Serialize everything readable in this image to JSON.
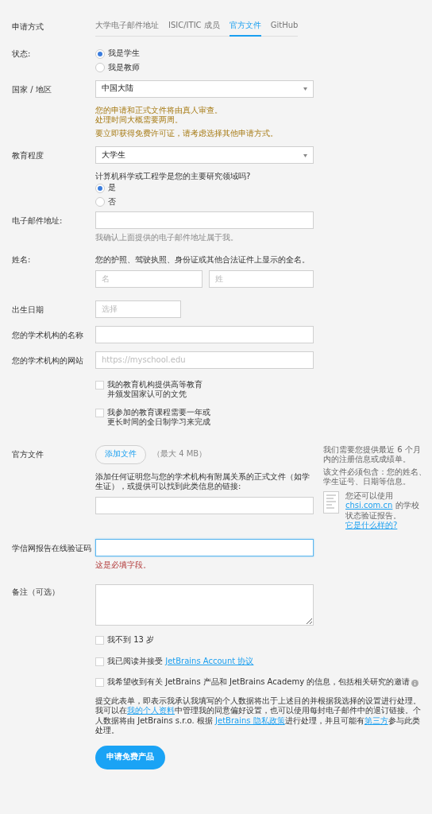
{
  "method": {
    "label": "申请方式",
    "tabs": [
      {
        "label": "大学电子邮件地址",
        "selected": false
      },
      {
        "label": "ISIC/ITIC 成员",
        "selected": false
      },
      {
        "label": "官方文件",
        "selected": true
      },
      {
        "label": "GitHub",
        "selected": false
      }
    ]
  },
  "status": {
    "label": "状态:",
    "options": [
      {
        "label": "我是学生",
        "selected": true
      },
      {
        "label": "我是教师",
        "selected": false
      }
    ]
  },
  "country": {
    "label": "国家 / 地区",
    "value": "中国大陆"
  },
  "notice": {
    "lines": [
      "您的申请和正式文件将由真人审查。",
      "处理时间大概需要两周。"
    ],
    "extra": "要立即获得免费许可证，请考虑选择其他申请方式。"
  },
  "education": {
    "label": "教育程度",
    "value": "大学生",
    "question": "计算机科学或工程学是您的主要研究领域吗?",
    "options": [
      {
        "label": "是",
        "selected": true
      },
      {
        "label": "否",
        "selected": false
      }
    ]
  },
  "email": {
    "label": "电子邮件地址:",
    "hint": "我确认上面提供的电子邮件地址属于我。"
  },
  "name": {
    "label": "姓名:",
    "description": "您的护照、驾驶执照、身份证或其他合法证件上显示的全名。",
    "first_placeholder": "名",
    "last_placeholder": "姓"
  },
  "birth_date": {
    "label": "出生日期",
    "placeholder": "选择"
  },
  "institution_name": {
    "label": "您的学术机构的名称"
  },
  "institution_site": {
    "label": "您的学术机构的网站",
    "placeholder": "https://myschool.edu"
  },
  "institution_checks": [
    {
      "lines": [
        "我的教育机构提供高等教育",
        "并颁发国家认可的文凭"
      ],
      "checked": false
    },
    {
      "lines": [
        "我参加的教育课程需要一年或",
        "更长时间的全日制学习来完成"
      ],
      "checked": false
    }
  ],
  "official_document": {
    "label": "官方文件",
    "button": "添加文件",
    "size_note": "（最大 4 MB）",
    "description": "添加任何证明您与您的学术机构有附属关系的正式文件（如学生证），或提供可以找到此类信息的链接:",
    "side_notes": [
      "我们需要您提供最近 6 个月内的注册信息或成绩单。",
      "该文件必须包含：您的姓名、学生证号、日期等信息。"
    ],
    "chsi": [
      {
        "text": "您还可以使用 "
      },
      {
        "text": "chsi.com.cn",
        "link": true
      },
      {
        "text": " 的学校状态验证报告。"
      }
    ],
    "example_link": "它是什么样的?"
  },
  "verification_code": {
    "label": "学信网报告在线验证码",
    "focused": true,
    "error": "这是必填字段。"
  },
  "notes": {
    "label": "备注（可选）"
  },
  "agreements": [
    {
      "segments": [
        {
          "text": "我不到 13 岁"
        }
      ],
      "checked": false
    },
    {
      "segments": [
        {
          "text": "我已阅读并接受 "
        },
        {
          "text": "JetBrains Account 协议",
          "link": true
        }
      ],
      "checked": false
    },
    {
      "segments": [
        {
          "text": "我希望收到有关 JetBrains 产品和 JetBrains Academy 的信息，包括相关研究的邀请"
        }
      ],
      "checked": false,
      "info": true
    }
  ],
  "consent": [
    {
      "text": "提交此表单，即表示我承认我填写的个人数据将出于上述目的并根据我选择的设置进行处理。我可以在"
    },
    {
      "text": "我的个人资料",
      "link": true
    },
    {
      "text": "中管理我的同意偏好设置，也可以使用每封电子邮件中的退订链接。个人数据将由 JetBrains s.r.o. 根据 "
    },
    {
      "text": "JetBrains 隐私政策",
      "link": true
    },
    {
      "text": "进行处理，并且可能有"
    },
    {
      "text": "第三方",
      "link": true
    },
    {
      "text": "参与此类处理。"
    }
  ],
  "submit": "申请免费产品"
}
